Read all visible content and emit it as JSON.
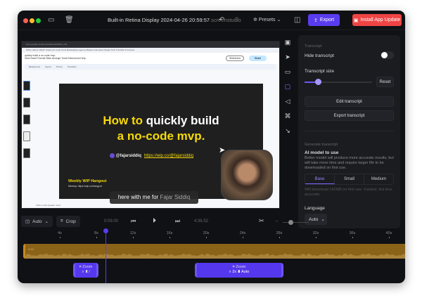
{
  "titlebar": {
    "title": "Built-in Retina Display 2024-04-26 20:59:57",
    "ext": ".screenstudio",
    "presets": "Presets",
    "export": "Export",
    "install": "Install App Update"
  },
  "screen": {
    "url": "docs.google.com/presentation/d/1HHS_m2l...",
    "bookmarks": "Office  Islamic  Watch  Studio  No Code  Tools  Marketplace  Agency  Makers  Interviews  Design  Tech  Tutorials & Courses",
    "doc_title": "quickly build a no-code mvp.",
    "menu": "View  Insert  Format  Slide  Arrange  Tools  Extensions  Help",
    "slideshow": "Slideshow",
    "share": "Share",
    "toolbar": "Background Layout Theme Transition",
    "line1a": "How to",
    "line1b": "quickly build",
    "line2": "a no-code mvp.",
    "handle": "@fajarsiddiq",
    "link": "https://wip.co/@fajarsiddiq",
    "wip": "Weekly WIP Hangout",
    "meetup": "Meetup: https://wip.co/hangout",
    "notes": "Click to add speaker notes",
    "caption_a": "here with me for",
    "caption_b": "Fajar Siddiq"
  },
  "panel": {
    "section": "Transcript",
    "hide": "Hide transcript",
    "hide_on": false,
    "size": "Transcript size",
    "size_value": 0.2,
    "reset": "Reset",
    "edit": "Edit transcript",
    "export": "Export transcript",
    "gen": "Generate transcript",
    "model_label": "AI model to use",
    "model_desc": "Better model will produce more accurate results, but will take more time and require larger file to be downloaded on first use.",
    "models": [
      "Base",
      "Small",
      "Medium"
    ],
    "model_note": "Will download 142MB on first use. Fastest, but less accurate.",
    "language_label": "Language",
    "language": "Auto"
  },
  "controls": {
    "layout": "Auto",
    "crop": "Crop",
    "current": "0:09.00",
    "total": "4:36.52"
  },
  "timeline": {
    "ticks": [
      "4s",
      "8s",
      "12s",
      "16s",
      "20s",
      "24s",
      "28s",
      "32s",
      "36s",
      "40s"
    ],
    "track_start": "0:00",
    "zoom1": "Zoom",
    "zoom2": "Zoom",
    "zoom2_detail": "2x",
    "zoom2_mode": "Auto"
  }
}
